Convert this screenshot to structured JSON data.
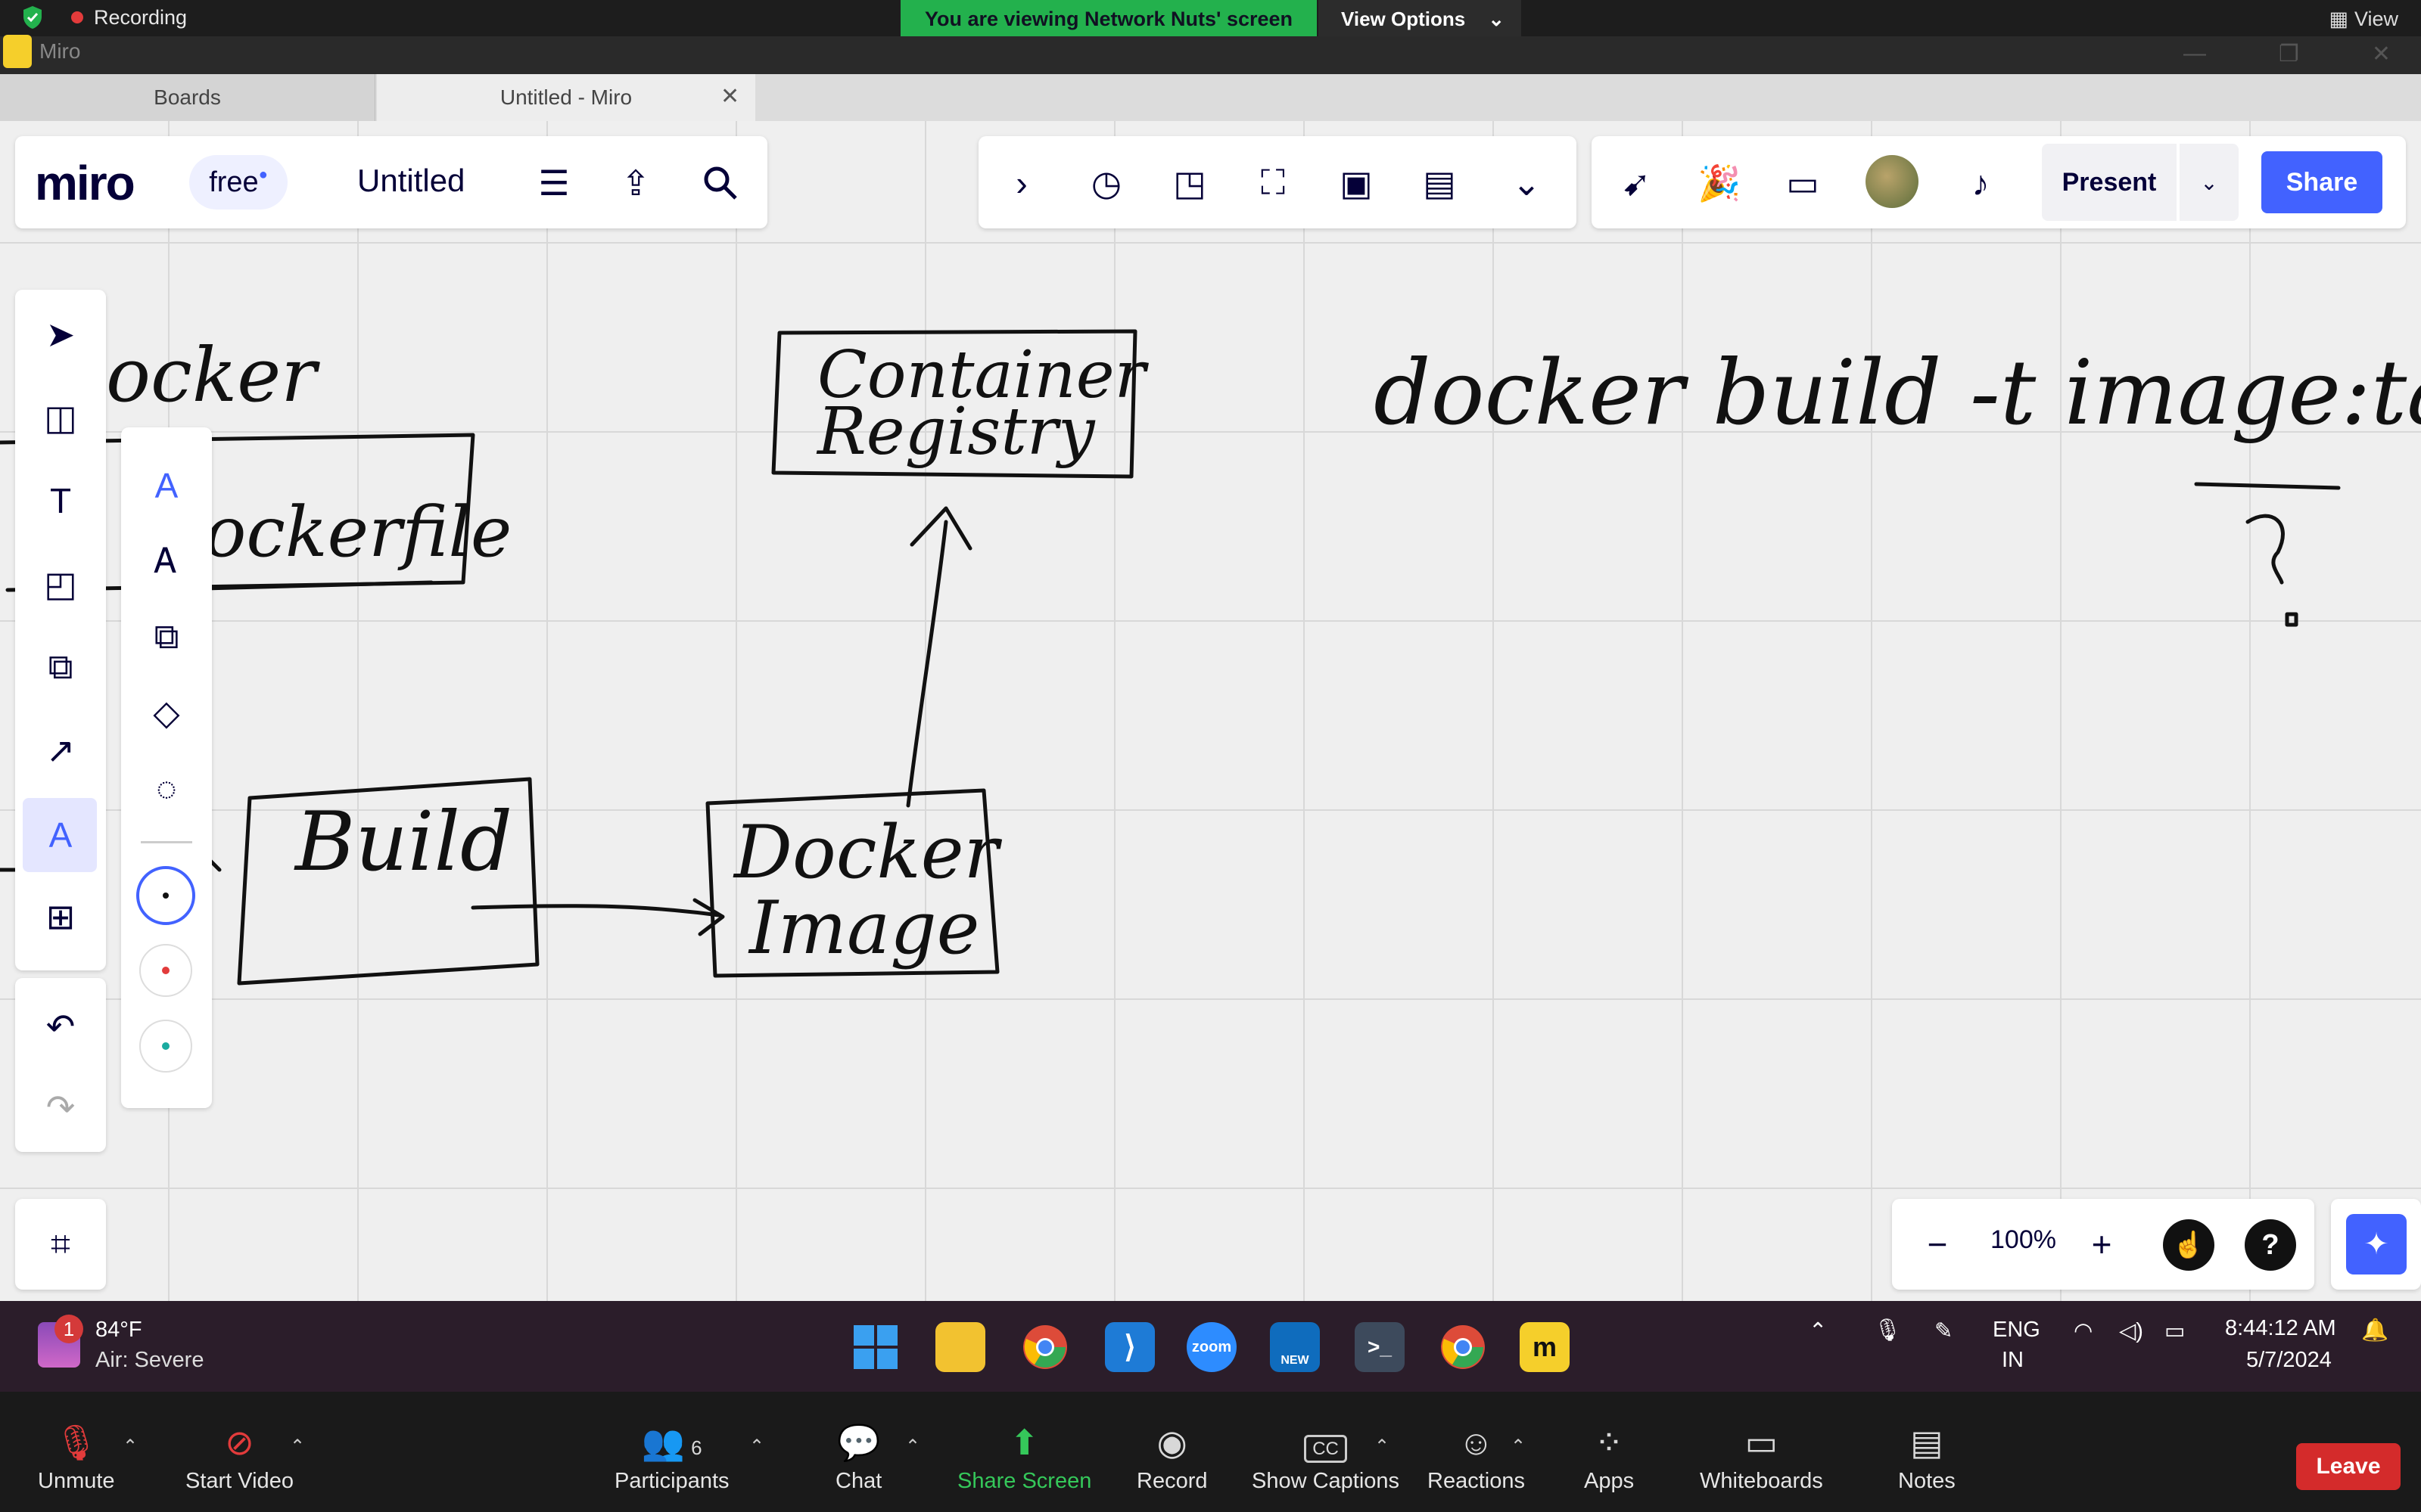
{
  "zoom_top": {
    "recording_label": "Recording",
    "viewing_banner": "You are viewing Network Nuts' screen",
    "view_options_label": "View Options",
    "view_label": "View"
  },
  "browser": {
    "app_name": "Miro",
    "tabs": [
      {
        "label": "Boards"
      },
      {
        "label": "Untitled - Miro",
        "close": "✕"
      }
    ]
  },
  "miro": {
    "logo": "miro",
    "plan_badge": "free",
    "board_title": "Untitled",
    "present_label": "Present",
    "share_label": "Share",
    "zoom_level": "100%",
    "zoom_out": "−",
    "zoom_in": "+",
    "help": "?"
  },
  "whiteboard": {
    "handwriting": {
      "docker_fragment": "ocker",
      "dockerfile_fragment": "ockerfile",
      "build": "Build",
      "docker_image_1": "Docker",
      "docker_image_2": "Image",
      "registry_1": "Container",
      "registry_2": "Registry",
      "command": "docker build -t image:tag .",
      "question": "?"
    }
  },
  "taskbar": {
    "weather_badge": "1",
    "temperature": "84°F",
    "air_quality": "Air: Severe",
    "language_1": "ENG",
    "language_2": "IN",
    "time": "8:44:12 AM",
    "date": "5/7/2024",
    "zoom_app_label": "zoom",
    "outlook_badge": "NEW"
  },
  "zoom_bottom": {
    "unmute": "Unmute",
    "start_video": "Start Video",
    "participants": "Participants",
    "participants_count": "6",
    "chat": "Chat",
    "share_screen": "Share Screen",
    "record": "Record",
    "show_captions": "Show Captions",
    "captions_badge": "CC",
    "reactions": "Reactions",
    "apps": "Apps",
    "whiteboards": "Whiteboards",
    "notes": "Notes",
    "leave": "Leave"
  },
  "colors": {
    "miro_blue": "#4262ff",
    "zoom_green": "#23b14d",
    "leave_red": "#d42b2b",
    "canvas_bg": "#efefef"
  }
}
